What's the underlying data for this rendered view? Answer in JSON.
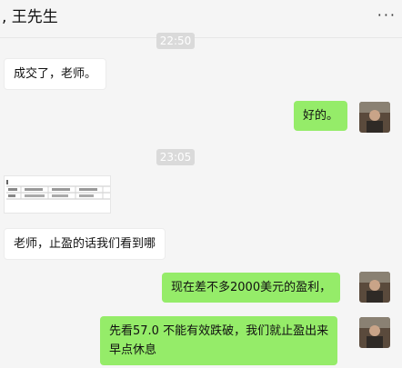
{
  "header": {
    "title": ", 王先生",
    "more_glyph": "···"
  },
  "timestamps": [
    "22:50",
    "23:05"
  ],
  "messages": [
    {
      "side": "left",
      "text": "成交了，老师。"
    },
    {
      "side": "right",
      "text": "好的。"
    },
    {
      "side": "left",
      "kind": "image",
      "icon": "screenshot-table-thumbnail"
    },
    {
      "side": "left",
      "text": "老师，止盈的话我们看到哪"
    },
    {
      "side": "right",
      "text": "现在差不多2000美元的盈利，"
    },
    {
      "side": "right",
      "text": "先看57.0 不能有效跌破，我们就止盈出来",
      "text2": "早点休息"
    }
  ],
  "colors": {
    "background": "#f5f5f5",
    "right_bubble": "#95ec69",
    "left_bubble": "#ffffff",
    "timestamp_bg": "#dadada"
  }
}
